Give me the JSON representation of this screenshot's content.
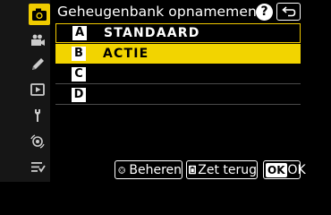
{
  "header": {
    "title": "Geheugenbank opnamemenu",
    "help_label": "?"
  },
  "sidebar": {
    "items": [
      {
        "name": "camera-icon",
        "active": true
      },
      {
        "name": "movie-camera-icon",
        "active": false
      },
      {
        "name": "pencil-icon",
        "active": false
      },
      {
        "name": "playback-icon",
        "active": false
      },
      {
        "name": "wrench-icon",
        "active": false
      },
      {
        "name": "network-icon",
        "active": false
      },
      {
        "name": "my-menu-icon",
        "active": false
      }
    ]
  },
  "banks": [
    {
      "letter": "A",
      "name": "STANDAARD",
      "state": "outlined"
    },
    {
      "letter": "B",
      "name": "ACTIE",
      "state": "selected"
    },
    {
      "letter": "C",
      "name": "",
      "state": "normal"
    },
    {
      "letter": "D",
      "name": "",
      "state": "normal"
    }
  ],
  "footer": {
    "manage_label": "Beheren",
    "reset_label": "Zet terug",
    "ok_key": "OK",
    "ok_label": "OK"
  },
  "colors": {
    "accent": "#f2d400",
    "background": "#000000",
    "rail": "#161616"
  }
}
